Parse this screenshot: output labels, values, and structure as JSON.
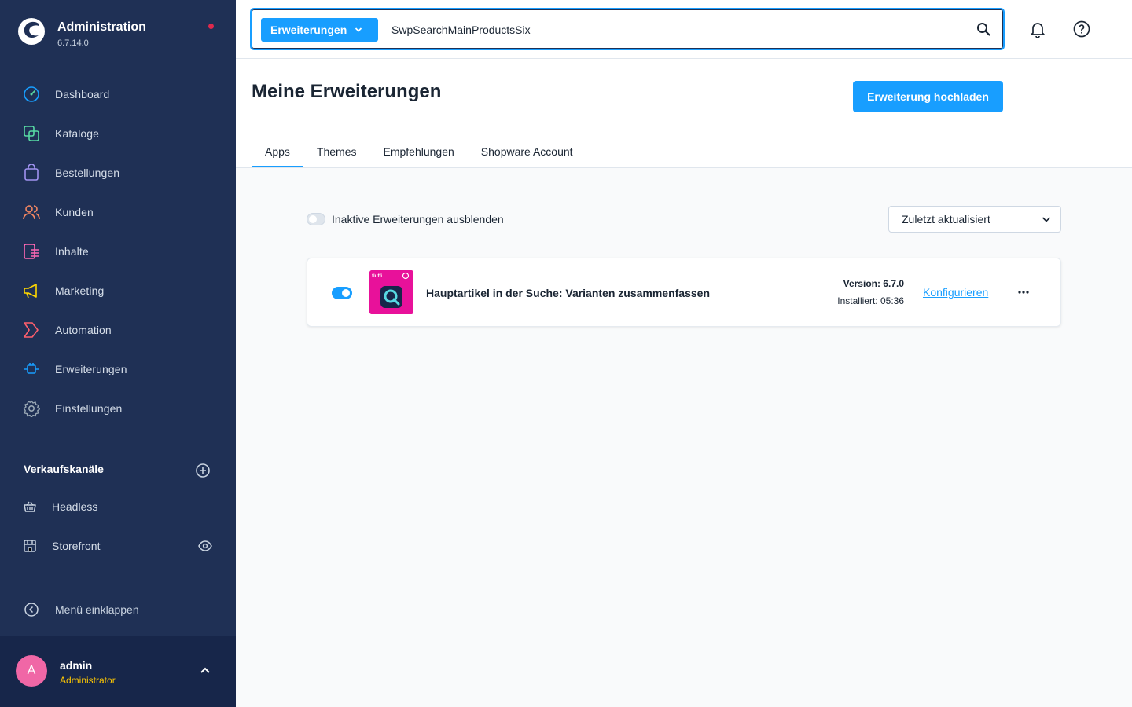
{
  "sidebar": {
    "title": "Administration",
    "version": "6.7.14.0",
    "items": [
      {
        "label": "Dashboard",
        "icon": "gauge-icon",
        "color": "#57d9a3"
      },
      {
        "label": "Kataloge",
        "icon": "catalog-icon",
        "color": "#57d9a3"
      },
      {
        "label": "Bestellungen",
        "icon": "shopping-bag-icon",
        "color": "#a092f0"
      },
      {
        "label": "Kunden",
        "icon": "users-icon",
        "color": "#f88962"
      },
      {
        "label": "Inhalte",
        "icon": "content-icon",
        "color": "#ff68b4"
      },
      {
        "label": "Marketing",
        "icon": "megaphone-icon",
        "color": "#ffd700"
      },
      {
        "label": "Automation",
        "icon": "automation-icon",
        "color": "#ff5f6d"
      },
      {
        "label": "Erweiterungen",
        "icon": "plug-icon",
        "color": "#189eff"
      },
      {
        "label": "Einstellungen",
        "icon": "gear-icon",
        "color": "#9aa8b5"
      }
    ],
    "sales_channels": {
      "title": "Verkaufskanäle",
      "items": [
        {
          "label": "Headless",
          "icon": "basket-icon"
        },
        {
          "label": "Storefront",
          "icon": "storefront-icon"
        }
      ]
    },
    "collapse_label": "Menü einklappen",
    "user": {
      "initial": "A",
      "name": "admin",
      "role": "Administrator"
    }
  },
  "topbar": {
    "search_type": "Erweiterungen",
    "search_value": "SwpSearchMainProductsSix"
  },
  "page": {
    "title": "Meine Erweiterungen",
    "upload_button": "Erweiterung hochladen",
    "tabs": [
      "Apps",
      "Themes",
      "Empfehlungen",
      "Shopware Account"
    ],
    "active_tab": "Apps"
  },
  "filters": {
    "hide_inactive_label": "Inaktive Erweiterungen ausblenden",
    "hide_inactive_on": false,
    "sort_value": "Zuletzt aktualisiert"
  },
  "extensions": [
    {
      "active": true,
      "name": "Hauptartikel in der Suche: Varianten zusammenfassen",
      "version": "Version: 6.7.0",
      "installed": "Installiert: 05:36",
      "configure_label": "Konfigurieren",
      "icon_text": "fluffi"
    }
  ],
  "colors": {
    "sidebar_bg": "#1f3055",
    "accent": "#189eff",
    "avatar": "#f067a6",
    "role": "#ffc802",
    "extension_icon": "#e8119a"
  }
}
